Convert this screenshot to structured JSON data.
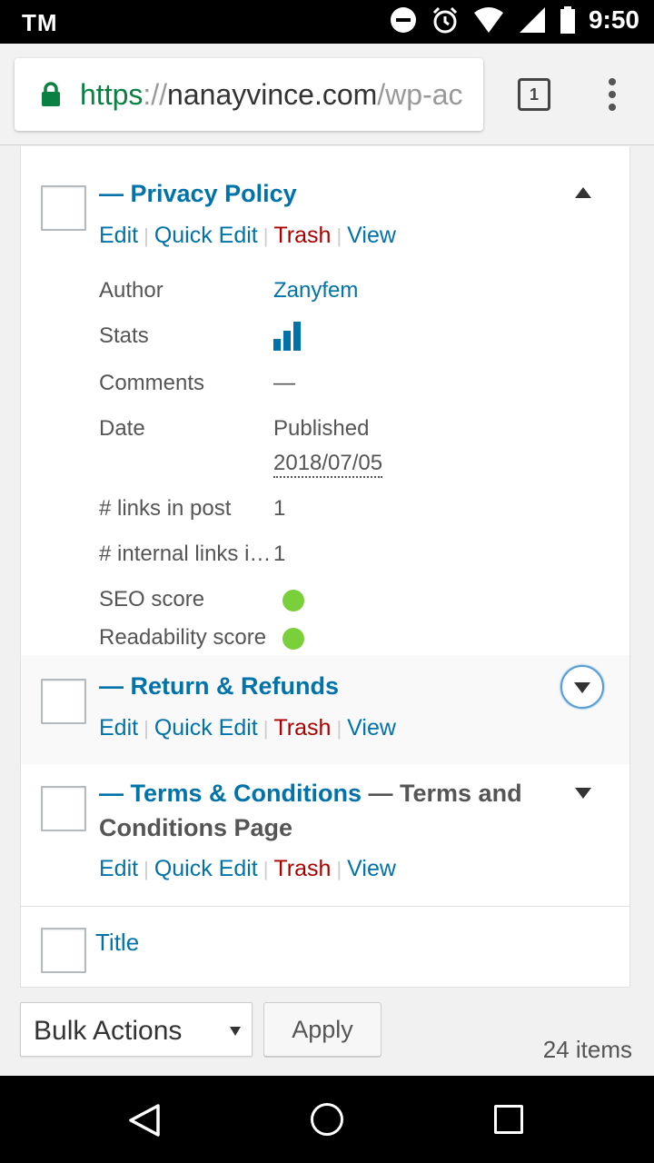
{
  "status_bar": {
    "carrier": "TM",
    "time": "9:50",
    "icons": [
      "do-not-disturb-icon",
      "alarm-icon",
      "wifi-icon",
      "signal-icon",
      "battery-icon"
    ]
  },
  "browser": {
    "url_scheme": "https",
    "url_sep": "://",
    "url_host": "nanayvince.com",
    "url_path": "/wp-ac",
    "tab_count": "1"
  },
  "colors": {
    "link": "#0073aa",
    "trash": "#aa0000",
    "seo_good": "#7ad03a",
    "url_green": "#0b8043"
  },
  "rows": [
    {
      "title": "— Privacy Policy",
      "actions": {
        "edit": "Edit",
        "quick_edit": "Quick Edit",
        "trash": "Trash",
        "view": "View"
      },
      "expanded": true,
      "details": {
        "author_label": "Author",
        "author_value": "Zanyfem",
        "stats_label": "Stats",
        "comments_label": "Comments",
        "comments_value": "—",
        "date_label": "Date",
        "date_status": "Published",
        "date_value": "2018/07/05",
        "links_label": "# links in post",
        "links_value": "1",
        "internal_label": "# internal links in post",
        "internal_value": "1",
        "seo_label": "SEO score",
        "seo_value": "good",
        "readability_label": "Readability score",
        "readability_value": "good"
      }
    },
    {
      "title": "— Return & Refunds",
      "actions": {
        "edit": "Edit",
        "quick_edit": "Quick Edit",
        "trash": "Trash",
        "view": "View"
      }
    },
    {
      "title": "— Terms & Conditions",
      "state_line1": " — Terms and",
      "state_line2": "Conditions Page",
      "actions": {
        "edit": "Edit",
        "quick_edit": "Quick Edit",
        "trash": "Trash",
        "view": "View"
      }
    }
  ],
  "footer": {
    "title_column": "Title"
  },
  "bulk": {
    "select_label": "Bulk Actions",
    "apply": "Apply",
    "items": "24 items"
  }
}
